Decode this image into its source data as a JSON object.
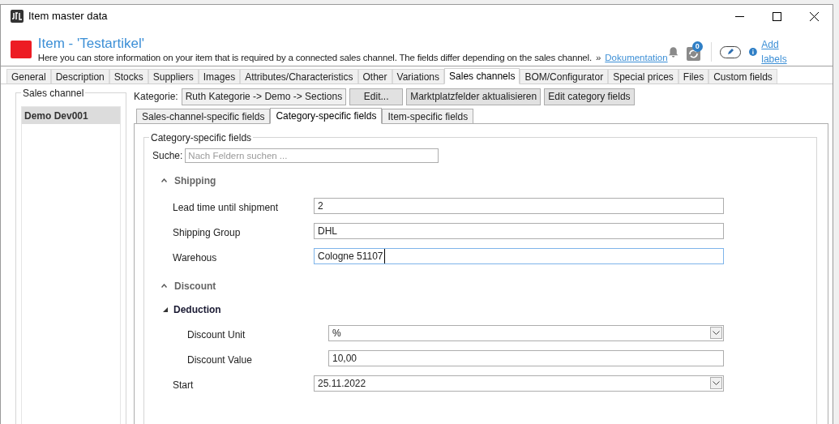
{
  "window": {
    "title": "Item master data"
  },
  "header": {
    "title": "Item - 'Testartikel'",
    "description": "Here you can store information on your item that is required by a connected sales channel. The fields differ depending on the sales channel.",
    "link_prefix": "»",
    "link": "Dokumentation",
    "sync_count": "0",
    "labels_link": "Add labels"
  },
  "tabs": [
    {
      "label": "General",
      "selected": false
    },
    {
      "label": "Description",
      "selected": false
    },
    {
      "label": "Stocks",
      "selected": false
    },
    {
      "label": "Suppliers",
      "selected": false
    },
    {
      "label": "Images",
      "selected": false
    },
    {
      "label": "Attributes/Characteristics",
      "selected": false
    },
    {
      "label": "Other",
      "selected": false
    },
    {
      "label": "Variations",
      "selected": false
    },
    {
      "label": "Sales channels",
      "selected": true
    },
    {
      "label": "BOM/Configurator",
      "selected": false
    },
    {
      "label": "Special prices",
      "selected": false
    },
    {
      "label": "Files",
      "selected": false
    },
    {
      "label": "Custom fields",
      "selected": false
    }
  ],
  "sales_channel": {
    "title": "Sales channel",
    "items": [
      {
        "label": "Demo Dev001",
        "selected": true
      }
    ]
  },
  "category": {
    "label": "Kategorie:",
    "value": "Ruth Kategorie -> Demo -> Sections",
    "buttons": [
      "Edit...",
      "Marktplatzfelder aktualisieren",
      "Edit category fields"
    ]
  },
  "sub_tabs": [
    {
      "label": "Sales-channel-specific fields",
      "selected": false
    },
    {
      "label": "Category-specific fields",
      "selected": true
    },
    {
      "label": "Item-specific fields",
      "selected": false
    }
  ],
  "fields_group": {
    "title": "Category-specific fields",
    "search_label": "Suche:",
    "search_placeholder": "Nach Feldern suchen ...",
    "rows": [
      {
        "kind": "section",
        "label": "Shipping",
        "expanded": true
      },
      {
        "kind": "text",
        "label": "Lead time until shipment",
        "value": "2",
        "focused": false
      },
      {
        "kind": "text",
        "label": "Shipping Group",
        "value": "DHL",
        "focused": false
      },
      {
        "kind": "text",
        "label": "Warehous",
        "value": "Cologne 51107",
        "focused": true
      },
      {
        "kind": "section",
        "label": "Discount",
        "expanded": true
      },
      {
        "kind": "subsection",
        "label": "Deduction",
        "expanded": true,
        "children": [
          {
            "kind": "dropdown",
            "label": "Discount Unit",
            "value": "%"
          },
          {
            "kind": "text",
            "label": "Discount Value",
            "value": "10,00",
            "focused": false
          }
        ]
      },
      {
        "kind": "dropdown",
        "label": "Start",
        "value": "25.11.2022"
      }
    ]
  }
}
